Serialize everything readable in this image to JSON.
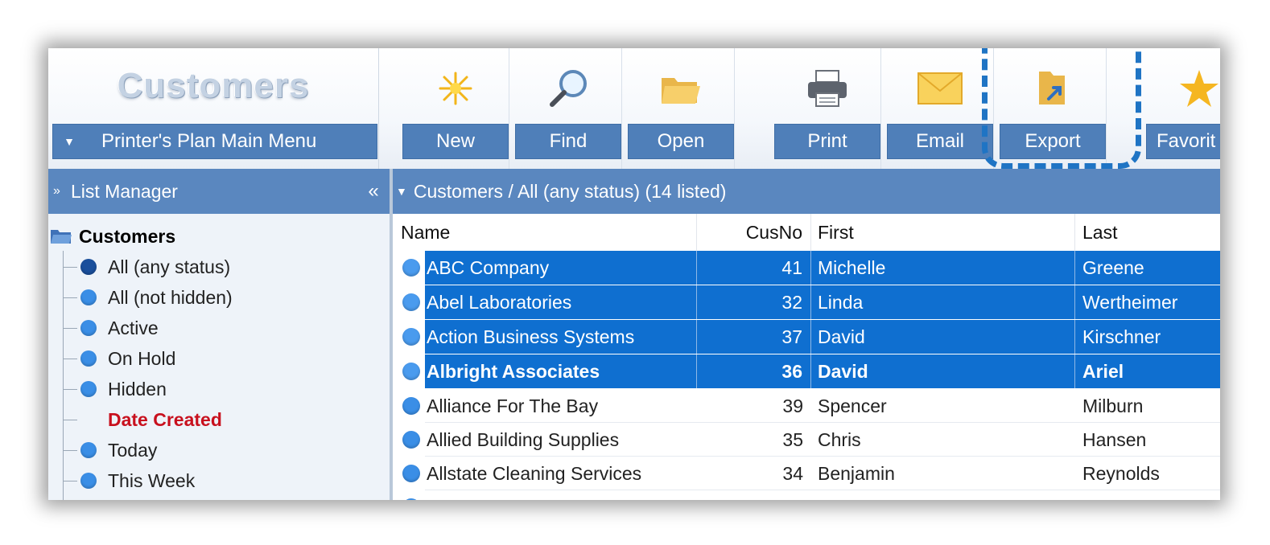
{
  "toolbar": {
    "title": "Customers",
    "main_menu_label": "Printer's Plan Main Menu",
    "buttons": [
      {
        "label": "New",
        "icon": "sparkle-icon"
      },
      {
        "label": "Find",
        "icon": "magnifier-icon"
      },
      {
        "label": "Open",
        "icon": "open-folder-icon"
      },
      {
        "label": "Print",
        "icon": "printer-icon"
      },
      {
        "label": "Email",
        "icon": "envelope-icon"
      },
      {
        "label": "Export",
        "icon": "export-folder-icon"
      },
      {
        "label": "Favorit",
        "icon": "star-icon"
      }
    ]
  },
  "list_manager": {
    "header": "List Manager",
    "collapse_glyph": "«",
    "root": "Customers",
    "items": [
      {
        "label": "All (any status)",
        "dot": "dark"
      },
      {
        "label": "All (not hidden)",
        "dot": "normal"
      },
      {
        "label": "Active",
        "dot": "normal"
      },
      {
        "label": "On Hold",
        "dot": "normal"
      },
      {
        "label": "Hidden",
        "dot": "normal"
      },
      {
        "label": "Date Created",
        "dot": "none"
      },
      {
        "label": "Today",
        "dot": "normal"
      },
      {
        "label": "This Week",
        "dot": "normal"
      }
    ]
  },
  "grid": {
    "header": "Customers / All (any status) (14 listed)",
    "columns": [
      "Name",
      "CusNo",
      "First",
      "Last"
    ],
    "rows": [
      {
        "name": "ABC Company",
        "cusno": "41",
        "first": "Michelle",
        "last": "Greene",
        "selected": true,
        "bold": false
      },
      {
        "name": "Abel Laboratories",
        "cusno": "32",
        "first": "Linda",
        "last": "Wertheimer",
        "selected": true,
        "bold": false
      },
      {
        "name": "Action Business Systems",
        "cusno": "37",
        "first": "David",
        "last": "Kirschner",
        "selected": true,
        "bold": false
      },
      {
        "name": "Albright Associates",
        "cusno": "36",
        "first": "David",
        "last": "Ariel",
        "selected": true,
        "bold": true
      },
      {
        "name": "Alliance For The Bay",
        "cusno": "39",
        "first": "Spencer",
        "last": "Milburn",
        "selected": false,
        "bold": false
      },
      {
        "name": "Allied Building Supplies",
        "cusno": "35",
        "first": "Chris",
        "last": "Hansen",
        "selected": false,
        "bold": false
      },
      {
        "name": "Allstate Cleaning Services",
        "cusno": "34",
        "first": "Benjamin",
        "last": "Reynolds",
        "selected": false,
        "bold": false
      }
    ]
  },
  "colors": {
    "accent": "#4f7fb9",
    "selection": "#0f6fd0",
    "highlight_dash": "#1f74c4",
    "date_created_red": "#c8101e"
  }
}
